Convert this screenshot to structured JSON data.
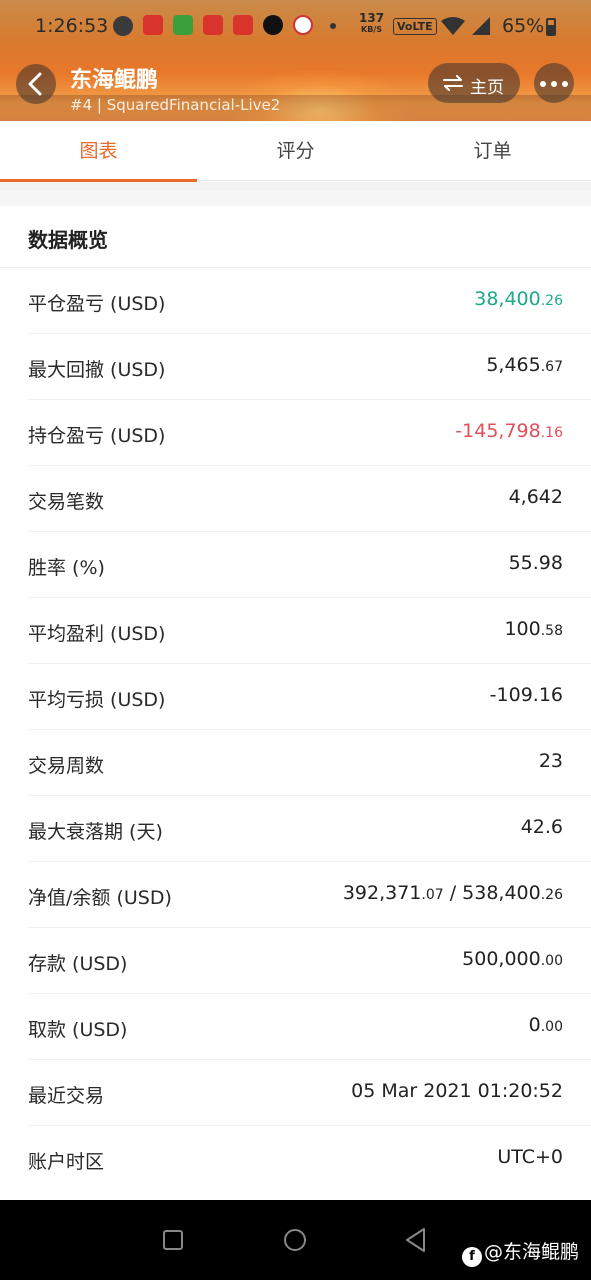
{
  "status_bar": {
    "time": "1:26:53",
    "speed_value": "137",
    "speed_unit": "KB/S",
    "volte": "VoLTE",
    "battery": "65%"
  },
  "header": {
    "title": "东海鲲鹏",
    "subtitle": "#4 | SquaredFinancial-Live2",
    "home_label": "主页"
  },
  "tabs": [
    {
      "label": "图表",
      "active": true
    },
    {
      "label": "评分",
      "active": false
    },
    {
      "label": "订单",
      "active": false
    }
  ],
  "overview": {
    "title": "数据概览",
    "rows": [
      {
        "label": "平仓盈亏 (USD)",
        "main": "38,400",
        "dec": ".26",
        "color": "#1fa88a"
      },
      {
        "label": "最大回撤 (USD)",
        "main": "5,465",
        "dec": ".67"
      },
      {
        "label": "持仓盈亏 (USD)",
        "main": "-145,798",
        "dec": ".16",
        "color": "#e0505a"
      },
      {
        "label": "交易笔数",
        "main": "4,642",
        "dec": ""
      },
      {
        "label": "胜率 (%)",
        "main": "55.98",
        "dec": ""
      },
      {
        "label": "平均盈利 (USD)",
        "main": "100",
        "dec": ".58"
      },
      {
        "label": "平均亏损 (USD)",
        "main": "-109.16",
        "dec": ""
      },
      {
        "label": "交易周数",
        "main": "23",
        "dec": ""
      },
      {
        "label": "最大衰落期 (天)",
        "main": "42.6",
        "dec": ""
      },
      {
        "label": "净值/余额 (USD)",
        "main": "392,371",
        "dec": ".07",
        "main2": " / 538,400",
        "dec2": ".26"
      },
      {
        "label": "存款 (USD)",
        "main": "500,000",
        "dec": ".00"
      },
      {
        "label": "取款 (USD)",
        "main": "0",
        "dec": ".00"
      },
      {
        "label": "最近交易",
        "main": "05 Mar 2021 01:20:52",
        "dec": ""
      },
      {
        "label": "账户时区",
        "main": "UTC+0",
        "dec": ""
      }
    ]
  },
  "watermark": {
    "icon_text": "f",
    "text": "@东海鲲鹏"
  },
  "colors": {
    "accent": "#ea6a2a",
    "profit": "#1fa88a",
    "loss": "#e0505a"
  }
}
